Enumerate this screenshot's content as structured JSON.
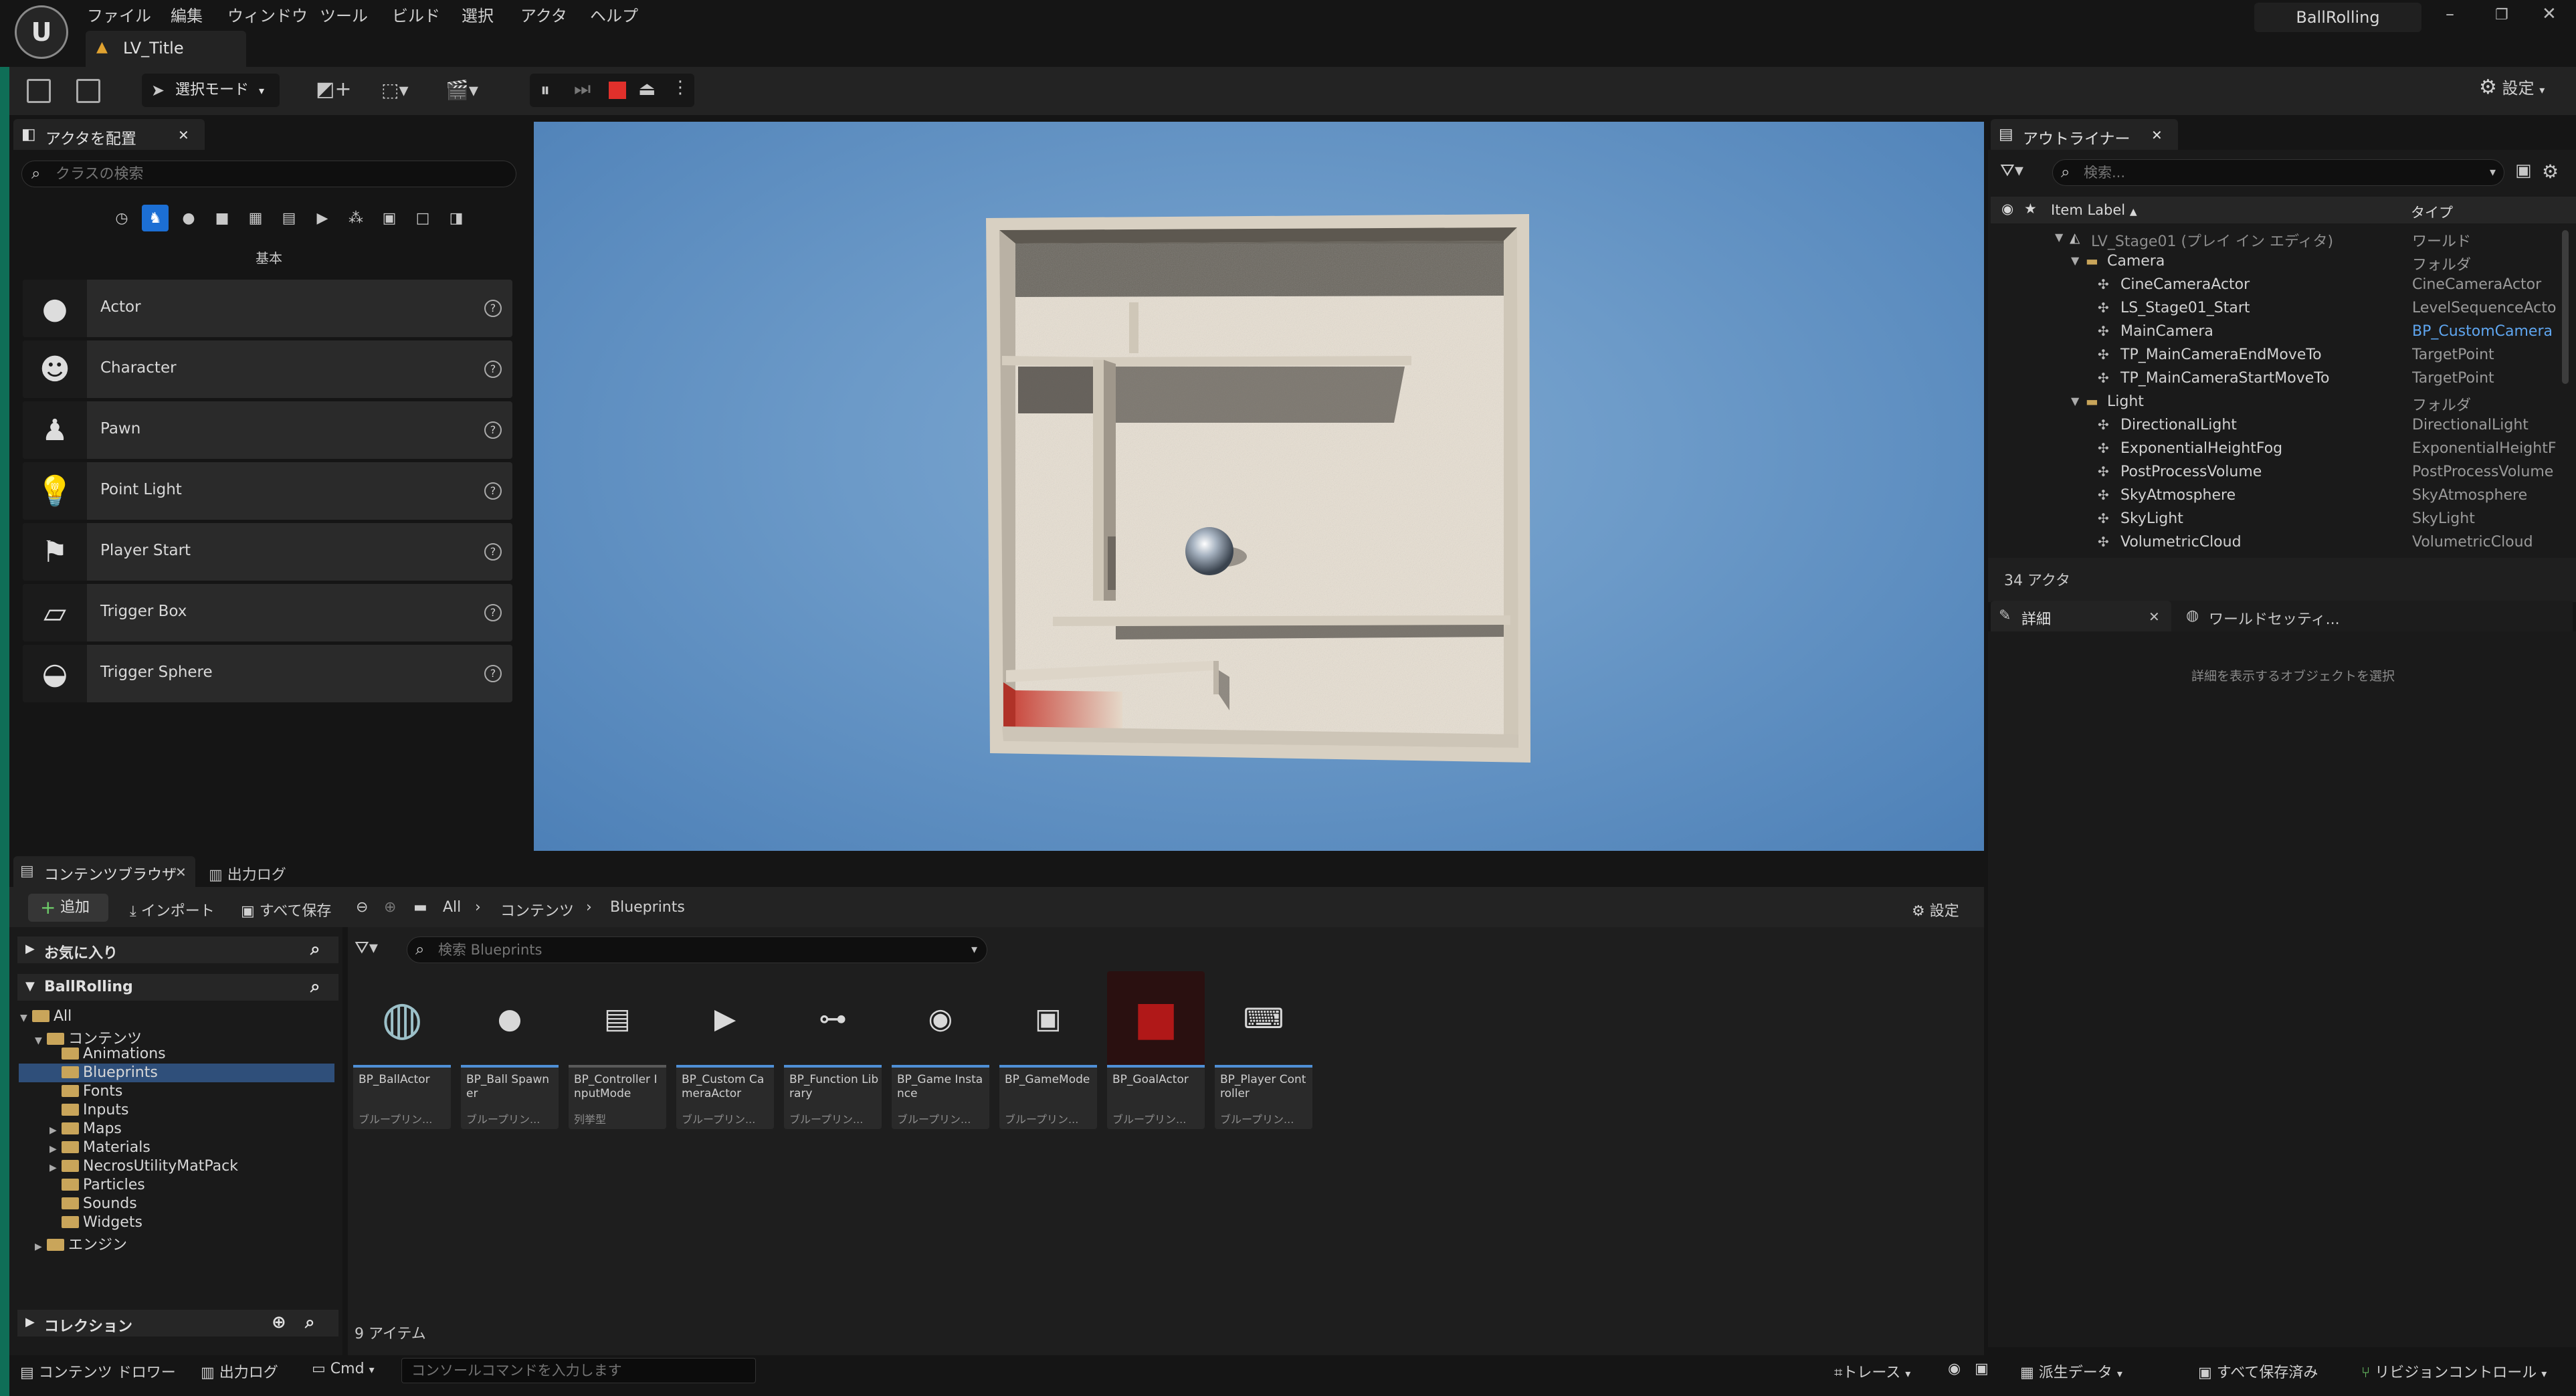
{
  "menu": [
    "ファイル",
    "編集",
    "ウィンドウ",
    "ツール",
    "ビルド",
    "選択",
    "アクタ",
    "ヘルプ"
  ],
  "level_tab": "LV_Title",
  "project_name": "BallRolling",
  "toolbar": {
    "mode_label": "選択モード",
    "settings_label": "設定"
  },
  "place_actors": {
    "tab_label": "アクタを配置",
    "search_placeholder": "クラスの検索",
    "category_label": "基本",
    "items": [
      "Actor",
      "Character",
      "Pawn",
      "Point Light",
      "Player Start",
      "Trigger Box",
      "Trigger Sphere"
    ]
  },
  "outliner": {
    "tab_label": "アウトライナー",
    "search_placeholder": "検索...",
    "col_label": "Item Label",
    "col_type": "タイプ",
    "rows": [
      {
        "name": "LV_Stage01 (プレイ イン エディタ)",
        "type": "ワールド",
        "indent": 0,
        "kind": "world"
      },
      {
        "name": "Camera",
        "type": "フォルダ",
        "indent": 1,
        "kind": "folder"
      },
      {
        "name": "CineCameraActor",
        "type": "CineCameraActor",
        "indent": 2,
        "kind": "actor"
      },
      {
        "name": "LS_Stage01_Start",
        "type": "LevelSequenceActo",
        "indent": 2,
        "kind": "actor"
      },
      {
        "name": "MainCamera",
        "type": "BP_CustomCamera",
        "indent": 2,
        "kind": "actor",
        "link": true
      },
      {
        "name": "TP_MainCameraEndMoveTo",
        "type": "TargetPoint",
        "indent": 2,
        "kind": "actor"
      },
      {
        "name": "TP_MainCameraStartMoveTo",
        "type": "TargetPoint",
        "indent": 2,
        "kind": "actor"
      },
      {
        "name": "Light",
        "type": "フォルダ",
        "indent": 1,
        "kind": "folder"
      },
      {
        "name": "DirectionalLight",
        "type": "DirectionalLight",
        "indent": 2,
        "kind": "actor"
      },
      {
        "name": "ExponentialHeightFog",
        "type": "ExponentialHeightF",
        "indent": 2,
        "kind": "actor"
      },
      {
        "name": "PostProcessVolume",
        "type": "PostProcessVolume",
        "indent": 2,
        "kind": "actor"
      },
      {
        "name": "SkyAtmosphere",
        "type": "SkyAtmosphere",
        "indent": 2,
        "kind": "actor"
      },
      {
        "name": "SkyLight",
        "type": "SkyLight",
        "indent": 2,
        "kind": "actor"
      },
      {
        "name": "VolumetricCloud",
        "type": "VolumetricCloud",
        "indent": 2,
        "kind": "actor"
      }
    ],
    "count": "34 アクタ"
  },
  "details": {
    "tab_details": "詳細",
    "tab_world": "ワールドセッティ...",
    "empty_text": "詳細を表示するオブジェクトを選択"
  },
  "content_browser": {
    "tab_label": "コンテンツブラウザ",
    "tab_output": "出力ログ",
    "add_label": "追加",
    "import_label": "インポート",
    "save_all_label": "すべて保存",
    "path": [
      "All",
      "コンテンツ",
      "Blueprints"
    ],
    "settings_label": "設定",
    "favorites_label": "お気に入り",
    "project_label": "BallRolling",
    "collections_label": "コレクション",
    "search_placeholder": "検索 Blueprints",
    "tree": [
      {
        "label": "All",
        "depth": 0,
        "expander": "open"
      },
      {
        "label": "コンテンツ",
        "depth": 1,
        "expander": "open"
      },
      {
        "label": "Animations",
        "depth": 2,
        "expander": ""
      },
      {
        "label": "Blueprints",
        "depth": 2,
        "expander": "",
        "selected": true
      },
      {
        "label": "Fonts",
        "depth": 2,
        "expander": ""
      },
      {
        "label": "Inputs",
        "depth": 2,
        "expander": ""
      },
      {
        "label": "Maps",
        "depth": 2,
        "expander": "closed"
      },
      {
        "label": "Materials",
        "depth": 2,
        "expander": "closed"
      },
      {
        "label": "NecrosUtilityMatPack",
        "depth": 2,
        "expander": "closed"
      },
      {
        "label": "Particles",
        "depth": 2,
        "expander": ""
      },
      {
        "label": "Sounds",
        "depth": 2,
        "expander": ""
      },
      {
        "label": "Widgets",
        "depth": 2,
        "expander": ""
      },
      {
        "label": "エンジン",
        "depth": 1,
        "expander": "closed"
      }
    ],
    "assets": [
      {
        "name": "BP_BallActor",
        "sub": "ブループリン..."
      },
      {
        "name": "BP_Ball Spawner",
        "sub": "ブループリン..."
      },
      {
        "name": "BP_Controller InputMode",
        "sub": "列挙型"
      },
      {
        "name": "BP_Custom CameraActor",
        "sub": "ブループリン..."
      },
      {
        "name": "BP_Function Library",
        "sub": "ブループリン..."
      },
      {
        "name": "BP_Game Instance",
        "sub": "ブループリン..."
      },
      {
        "name": "BP_GameMode",
        "sub": "ブループリン..."
      },
      {
        "name": "BP_GoalActor",
        "sub": "ブループリン..."
      },
      {
        "name": "BP_Player Controller",
        "sub": "ブループリン..."
      }
    ],
    "item_count": "9 アイテム"
  },
  "statusbar": {
    "content_drawer": "コンテンツ ドロワー",
    "output_log": "出力ログ",
    "cmd": "Cmd",
    "console_placeholder": "コンソールコマンドを入力します",
    "trace": "トレース",
    "derived_data": "派生データ",
    "all_saved": "すべて保存済み",
    "revision_control": "リビジョンコントロール"
  }
}
